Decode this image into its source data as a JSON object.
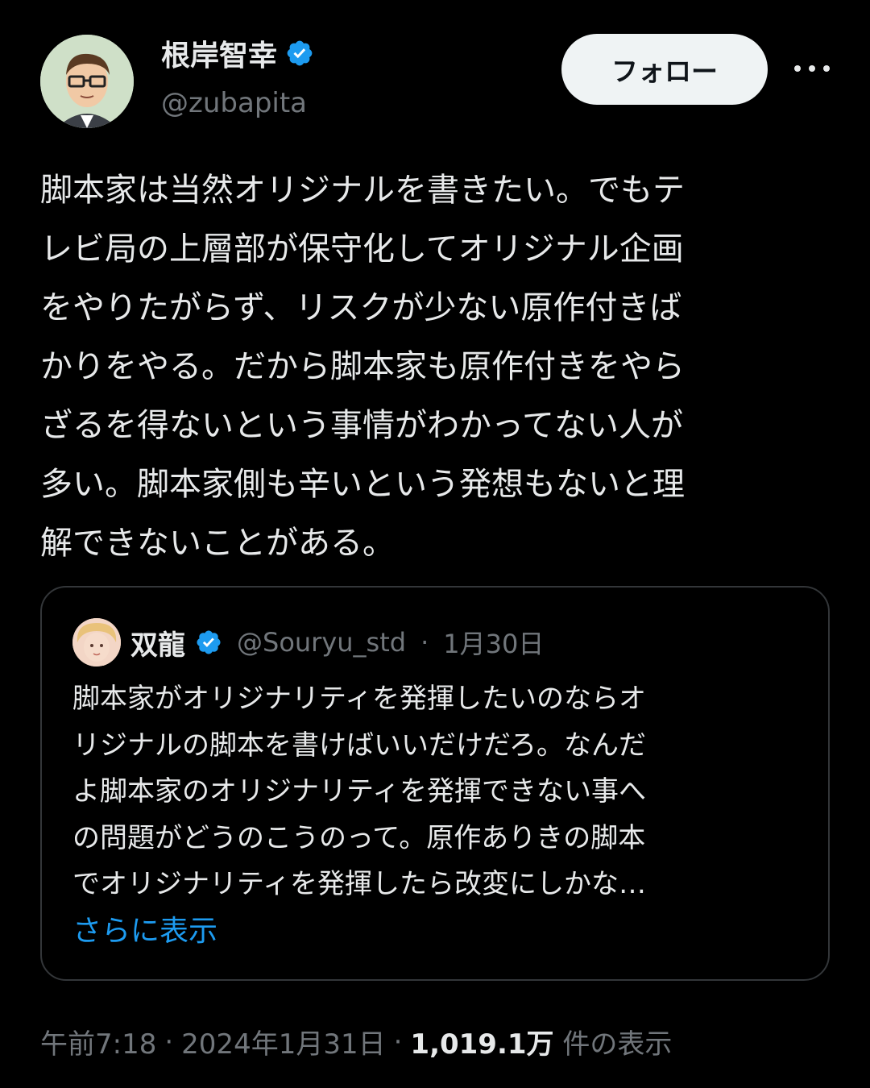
{
  "author": {
    "name": "根岸智幸",
    "handle": "@zubapita",
    "verified": true
  },
  "follow_button": {
    "label": "フォロー"
  },
  "more_icon": "more-horizontal-icon",
  "tweet": {
    "text": "脚本家は当然オリジナルを書きたい。でもテ\nレビ局の上層部が保守化してオリジナル企画\nをやりたがらず、リスクが少ない原作付きば\nかりをやる。だから脚本家も原作付きをやら\nざるを得ないという事情がわかってない人が\n多い。脚本家側も辛いという発想もないと理\n解できないことがある。",
    "time": "午前7:18",
    "date": "2024年1月31日",
    "views_count": "1,019.1万",
    "views_label": "件の表示"
  },
  "quoted": {
    "name": "双龍",
    "handle": "@Souryu_std",
    "date": "1月30日",
    "text": "脚本家がオリジナリティを発揮したいのならオ\nリジナルの脚本を書けばいいだけだろ。なんだ\nよ脚本家のオリジナリティを発揮できない事へ\nの問題がどうのこうのって。原作ありきの脚本\nでオリジナリティを発揮したら改変にしかな…",
    "show_more": "さらに表示"
  },
  "colors": {
    "background": "#000000",
    "text": "#e7e9ea",
    "muted": "#71767b",
    "link": "#1d9bf0",
    "verified": "#1d9bf0"
  },
  "separator": "·"
}
